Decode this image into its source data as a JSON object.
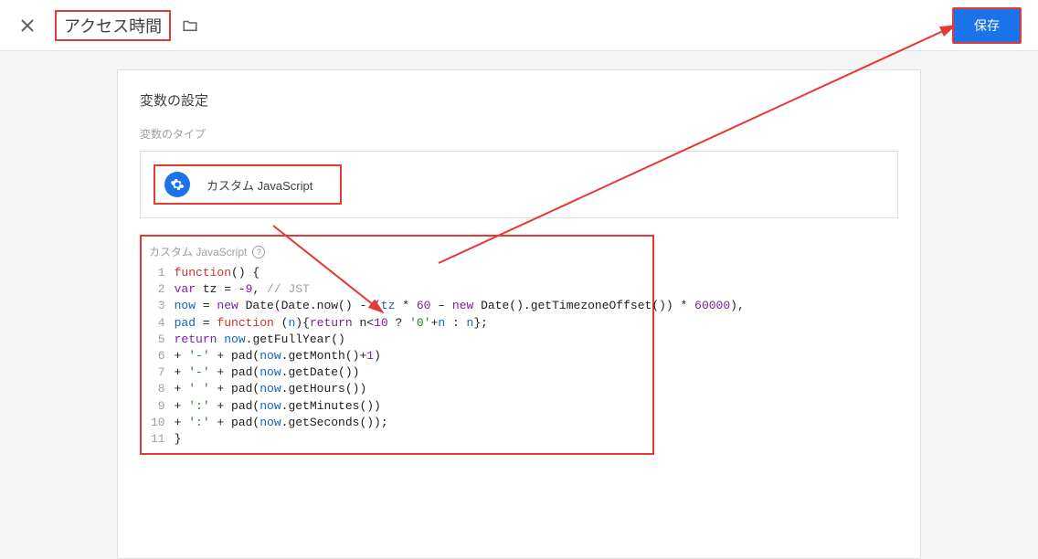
{
  "header": {
    "title": "アクセス時間",
    "save_label": "保存"
  },
  "panel": {
    "title": "変数の設定",
    "type_section_label": "変数のタイプ",
    "type_name": "カスタム JavaScript",
    "code_label": "カスタム JavaScript",
    "code_lines": [
      [
        {
          "cls": "kw-red",
          "t": "function"
        },
        {
          "cls": "txt",
          "t": "() {"
        }
      ],
      [
        {
          "cls": "kw-purple",
          "t": "var"
        },
        {
          "cls": "txt",
          "t": " tz = -"
        },
        {
          "cls": "num-purple",
          "t": "9"
        },
        {
          "cls": "txt",
          "t": ", "
        },
        {
          "cls": "comment",
          "t": "// JST"
        }
      ],
      [
        {
          "cls": "kw-blue",
          "t": "now"
        },
        {
          "cls": "txt",
          "t": " = "
        },
        {
          "cls": "kw-purple",
          "t": "new"
        },
        {
          "cls": "txt",
          "t": " Date(Date.now() - ("
        },
        {
          "cls": "kw-blue",
          "t": "tz"
        },
        {
          "cls": "txt",
          "t": " * "
        },
        {
          "cls": "num-purple",
          "t": "60"
        },
        {
          "cls": "txt",
          "t": " – "
        },
        {
          "cls": "kw-purple",
          "t": "new"
        },
        {
          "cls": "txt",
          "t": " Date().getTimezoneOffset()) * "
        },
        {
          "cls": "num-purple",
          "t": "60000"
        },
        {
          "cls": "txt",
          "t": "),"
        }
      ],
      [
        {
          "cls": "kw-blue",
          "t": "pad"
        },
        {
          "cls": "txt",
          "t": " = "
        },
        {
          "cls": "kw-red",
          "t": "function"
        },
        {
          "cls": "txt",
          "t": " ("
        },
        {
          "cls": "kw-blue",
          "t": "n"
        },
        {
          "cls": "txt",
          "t": "){"
        },
        {
          "cls": "kw-purple",
          "t": "return"
        },
        {
          "cls": "txt",
          "t": " n<"
        },
        {
          "cls": "num-purple",
          "t": "10"
        },
        {
          "cls": "txt",
          "t": " ? "
        },
        {
          "cls": "str-green",
          "t": "'0'"
        },
        {
          "cls": "txt",
          "t": "+"
        },
        {
          "cls": "kw-blue",
          "t": "n"
        },
        {
          "cls": "txt",
          "t": " : "
        },
        {
          "cls": "kw-blue",
          "t": "n"
        },
        {
          "cls": "txt",
          "t": "};"
        }
      ],
      [
        {
          "cls": "kw-purple",
          "t": "return"
        },
        {
          "cls": "txt",
          "t": " "
        },
        {
          "cls": "kw-blue",
          "t": "now"
        },
        {
          "cls": "txt",
          "t": ".getFullYear()"
        }
      ],
      [
        {
          "cls": "txt",
          "t": "+ "
        },
        {
          "cls": "str-green",
          "t": "'-'"
        },
        {
          "cls": "txt",
          "t": " + pad("
        },
        {
          "cls": "kw-blue",
          "t": "now"
        },
        {
          "cls": "txt",
          "t": ".getMonth()+"
        },
        {
          "cls": "num-purple",
          "t": "1"
        },
        {
          "cls": "txt",
          "t": ")"
        }
      ],
      [
        {
          "cls": "txt",
          "t": "+ "
        },
        {
          "cls": "str-green",
          "t": "'-'"
        },
        {
          "cls": "txt",
          "t": " + pad("
        },
        {
          "cls": "kw-blue",
          "t": "now"
        },
        {
          "cls": "txt",
          "t": ".getDate())"
        }
      ],
      [
        {
          "cls": "txt",
          "t": "+ "
        },
        {
          "cls": "str-green",
          "t": "' '"
        },
        {
          "cls": "txt",
          "t": " + pad("
        },
        {
          "cls": "kw-blue",
          "t": "now"
        },
        {
          "cls": "txt",
          "t": ".getHours())"
        }
      ],
      [
        {
          "cls": "txt",
          "t": "+ "
        },
        {
          "cls": "str-green",
          "t": "':'"
        },
        {
          "cls": "txt",
          "t": " + pad("
        },
        {
          "cls": "kw-blue",
          "t": "now"
        },
        {
          "cls": "txt",
          "t": ".getMinutes())"
        }
      ],
      [
        {
          "cls": "txt",
          "t": "+ "
        },
        {
          "cls": "str-green",
          "t": "':'"
        },
        {
          "cls": "txt",
          "t": " + pad("
        },
        {
          "cls": "kw-blue",
          "t": "now"
        },
        {
          "cls": "txt",
          "t": ".getSeconds());"
        }
      ],
      [
        {
          "cls": "txt",
          "t": "}"
        }
      ]
    ]
  }
}
